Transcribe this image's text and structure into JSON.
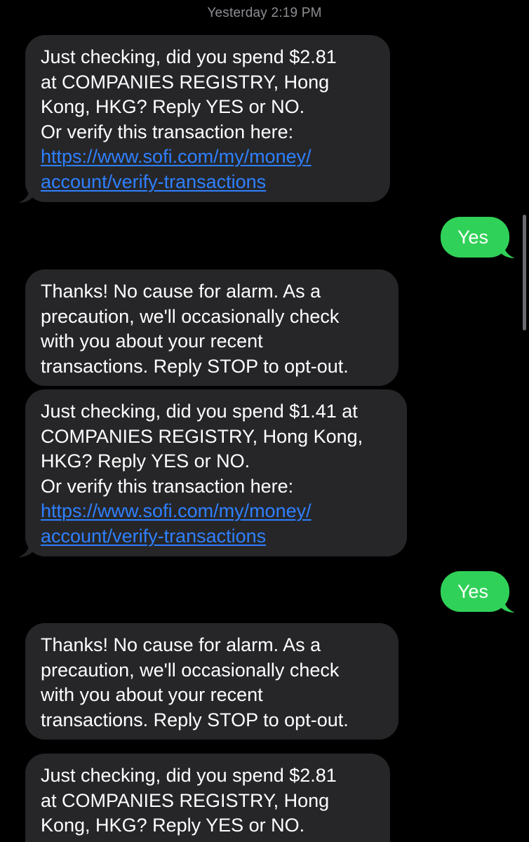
{
  "thread": {
    "timestamp": "Yesterday 2:19 PM",
    "messages": [
      {
        "direction": "incoming",
        "lines": [
          "Just checking, did you spend $2.81",
          "at COMPANIES REGISTRY, Hong",
          "Kong, HKG? Reply YES or NO.",
          "Or verify this transaction here:"
        ],
        "link_lines": [
          "https://www.sofi.com/my/money/",
          "account/verify-transactions"
        ]
      },
      {
        "direction": "outgoing",
        "text": "Yes"
      },
      {
        "direction": "incoming",
        "lines": [
          "Thanks! No cause for alarm. As a",
          "precaution, we'll occasionally check",
          "with you about your recent",
          "transactions. Reply STOP to opt-out."
        ]
      },
      {
        "direction": "incoming",
        "lines": [
          "Just checking, did you spend $1.41 at",
          "COMPANIES REGISTRY, Hong Kong,",
          "HKG? Reply YES or NO.",
          "Or verify this transaction here:"
        ],
        "link_lines": [
          "https://www.sofi.com/my/money/",
          "account/verify-transactions"
        ]
      },
      {
        "direction": "outgoing",
        "text": "Yes"
      },
      {
        "direction": "incoming",
        "lines": [
          "Thanks! No cause for alarm. As a",
          "precaution, we'll occasionally check",
          "with you about your recent",
          "transactions. Reply STOP to opt-out."
        ]
      },
      {
        "direction": "incoming",
        "lines": [
          "Just checking, did you spend $2.81",
          "at COMPANIES REGISTRY, Hong",
          "Kong, HKG? Reply YES or NO."
        ]
      }
    ]
  },
  "colors": {
    "background": "#000000",
    "incoming_bubble": "#262629",
    "outgoing_bubble": "#30d158",
    "link": "#2f80ff",
    "timestamp_text": "#8e8e93"
  }
}
